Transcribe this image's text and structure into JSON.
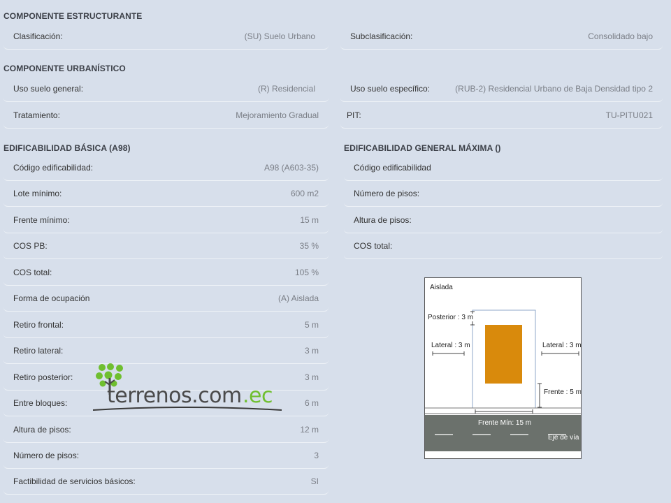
{
  "sections": {
    "estructurante": "COMPONENTE ESTRUCTURANTE",
    "urbanistico": "COMPONENTE URBANÍSTICO",
    "basica": "EDIFICABILIDAD BÁSICA (A98)",
    "maxima": "EDIFICABILIDAD GENERAL MÁXIMA ()"
  },
  "estructurante": {
    "clasificacion": {
      "label": "Clasificación:",
      "value": "(SU) Suelo Urbano"
    },
    "subclasificacion": {
      "label": "Subclasificación:",
      "value": "Consolidado bajo"
    }
  },
  "urbanistico": {
    "uso_general": {
      "label": "Uso suelo general:",
      "value": "(R) Residencial"
    },
    "uso_especifico": {
      "label": "Uso suelo específico:",
      "value": "(RUB-2) Residencial Urbano de Baja Densidad tipo 2"
    },
    "tratamiento": {
      "label": "Tratamiento:",
      "value": "Mejoramiento Gradual"
    },
    "pit": {
      "label": "PIT:",
      "value": "TU-PITU021"
    }
  },
  "basica": [
    {
      "label": "Código edificabilidad:",
      "value": "A98 (A603-35)"
    },
    {
      "label": "Lote mínimo:",
      "value": "600 m2"
    },
    {
      "label": "Frente mínimo:",
      "value": "15 m"
    },
    {
      "label": "COS PB:",
      "value": "35 %"
    },
    {
      "label": "COS total:",
      "value": "105 %"
    },
    {
      "label": "Forma de ocupación",
      "value": "(A) Aislada"
    },
    {
      "label": "Retiro frontal:",
      "value": "5 m"
    },
    {
      "label": "Retiro lateral:",
      "value": "3 m"
    },
    {
      "label": "Retiro posterior:",
      "value": "3 m"
    },
    {
      "label": "Entre bloques:",
      "value": "6 m"
    },
    {
      "label": "Altura de pisos:",
      "value": "12 m"
    },
    {
      "label": "Número de pisos:",
      "value": "3"
    },
    {
      "label": "Factibilidad de servicios básicos:",
      "value": "SI"
    }
  ],
  "maxima": [
    {
      "label": "Código edificabilidad",
      "value": ""
    },
    {
      "label": "Número de pisos:",
      "value": ""
    },
    {
      "label": "Altura de pisos:",
      "value": ""
    },
    {
      "label": "COS total:",
      "value": ""
    }
  ],
  "diagram": {
    "type_label": "Aislada",
    "posterior": "Posterior : 3 m",
    "lateral_left": "Lateral : 3 m",
    "lateral_right": "Lateral : 3 m",
    "frente": "Frente : 5 m",
    "frente_min": "Frente Mín: 15 m",
    "eje_via": "Eje de vía"
  },
  "logo": {
    "text_main": "terrenos.com",
    "text_ext": ".ec"
  },
  "colors": {
    "background": "#d7dfeb",
    "building": "#d98a0c",
    "road": "#6b716c",
    "logo_green": "#6fbf2f"
  }
}
